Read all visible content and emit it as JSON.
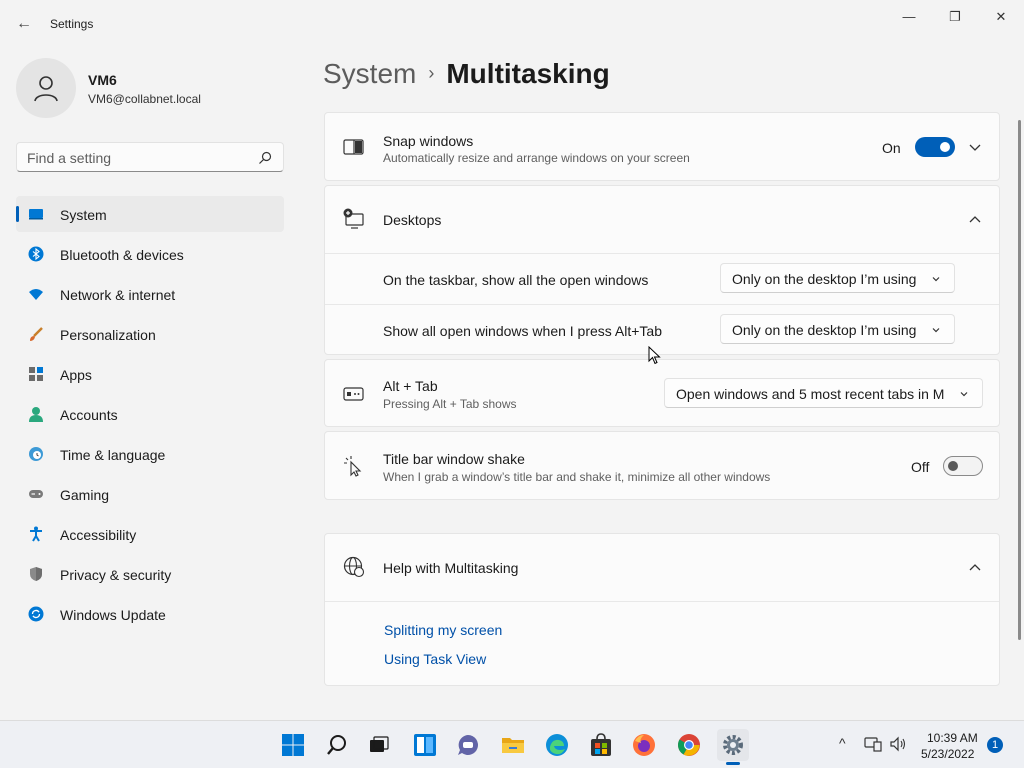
{
  "window": {
    "title": "Settings",
    "back_glyph": "←",
    "minimize_glyph": "—",
    "maximize_glyph": "❐",
    "close_glyph": "✕"
  },
  "user": {
    "name": "VM6",
    "email": "VM6@collabnet.local"
  },
  "search": {
    "placeholder": "Find a setting"
  },
  "nav": {
    "items": [
      {
        "label": "System",
        "icon": "system-display-icon",
        "active": true
      },
      {
        "label": "Bluetooth & devices",
        "icon": "bluetooth-icon"
      },
      {
        "label": "Network & internet",
        "icon": "wifi-icon"
      },
      {
        "label": "Personalization",
        "icon": "brush-icon"
      },
      {
        "label": "Apps",
        "icon": "apps-grid-icon"
      },
      {
        "label": "Accounts",
        "icon": "person-icon"
      },
      {
        "label": "Time & language",
        "icon": "globe-clock-icon"
      },
      {
        "label": "Gaming",
        "icon": "gamepad-icon"
      },
      {
        "label": "Accessibility",
        "icon": "accessibility-icon"
      },
      {
        "label": "Privacy & security",
        "icon": "shield-icon"
      },
      {
        "label": "Windows Update",
        "icon": "update-icon"
      }
    ]
  },
  "breadcrumb": {
    "parent": "System",
    "separator": "›",
    "current": "Multitasking"
  },
  "snap": {
    "title": "Snap windows",
    "subtitle": "Automatically resize and arrange windows on your screen",
    "state_label": "On",
    "enabled": true
  },
  "desktops": {
    "title": "Desktops",
    "rows": [
      {
        "label": "On the taskbar, show all the open windows",
        "value": "Only on the desktop I’m using"
      },
      {
        "label": "Show all open windows when I press Alt+Tab",
        "value": "Only on the desktop I’m using"
      }
    ]
  },
  "alttab": {
    "title": "Alt + Tab",
    "subtitle": "Pressing Alt + Tab shows",
    "value": "Open windows and 5 most recent tabs in M"
  },
  "shake": {
    "title": "Title bar window shake",
    "subtitle": "When I grab a window’s title bar and shake it, minimize all other windows",
    "state_label": "Off",
    "enabled": false
  },
  "help": {
    "title": "Help with Multitasking",
    "links": [
      "Splitting my screen",
      "Using Task View"
    ]
  },
  "taskbar": {
    "apps": [
      "start-icon",
      "search-icon",
      "task-view-icon",
      "widgets-icon",
      "chat-icon",
      "file-explorer-icon",
      "edge-icon",
      "store-icon",
      "firefox-icon",
      "chrome-icon",
      "settings-icon"
    ],
    "tray": {
      "chevron": "^",
      "notification_count": "1"
    },
    "clock": {
      "time": "10:39 AM",
      "date": "5/23/2022"
    }
  },
  "colors": {
    "accent": "#005fb8",
    "link": "#0050a8",
    "background": "#f3f3f3",
    "card": "#fbfbfb"
  }
}
